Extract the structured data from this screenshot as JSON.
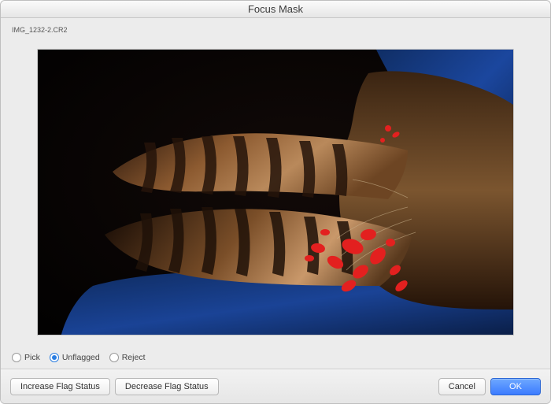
{
  "window": {
    "title": "Focus Mask"
  },
  "file": {
    "name": "IMG_1232-2.CR2"
  },
  "flags": {
    "options": [
      {
        "id": "pick",
        "label": "Pick",
        "selected": false
      },
      {
        "id": "unflagged",
        "label": "Unflagged",
        "selected": true
      },
      {
        "id": "reject",
        "label": "Reject",
        "selected": false
      }
    ]
  },
  "footer": {
    "increase_label": "Increase Flag Status",
    "decrease_label": "Decrease Flag Status",
    "cancel_label": "Cancel",
    "ok_label": "OK"
  },
  "colors": {
    "accent": "#2a7de1",
    "primary_button": "#3b7bff",
    "mask_overlay": "#e3201f"
  }
}
